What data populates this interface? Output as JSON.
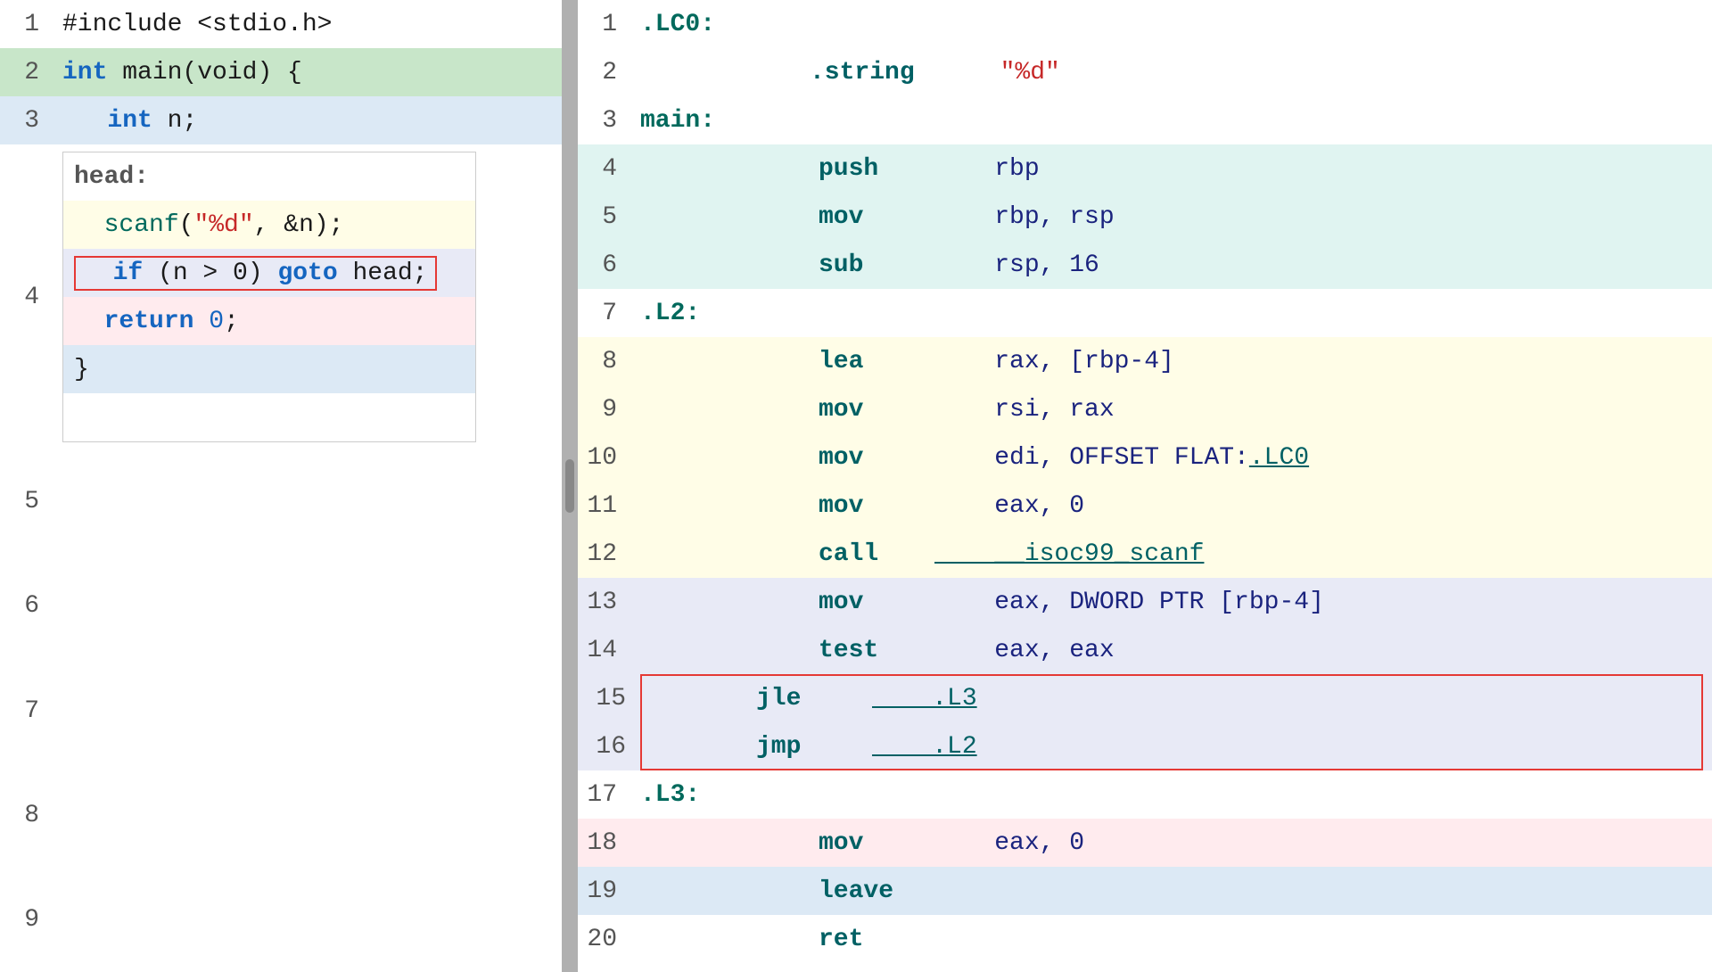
{
  "left": {
    "lines": [
      {
        "num": 1,
        "bg": "bg-white",
        "content": "#include <stdio.h>",
        "type": "plain_include"
      },
      {
        "num": 2,
        "bg": "bg-green-light",
        "content": "int main(void) {",
        "type": "main_decl"
      },
      {
        "num": 3,
        "bg": "bg-blue-light",
        "content": "  int n;",
        "type": "int_n"
      },
      {
        "num": 4,
        "bg": "bg-white",
        "content": "head:",
        "type": "label_head"
      },
      {
        "num": 5,
        "bg": "bg-yellow-light",
        "content": "  scanf(\"%d\", &n);",
        "type": "scanf"
      },
      {
        "num": 6,
        "bg": "bg-purple-light",
        "content": "  if (n > 0) goto head;",
        "type": "if_goto",
        "boxed": true
      },
      {
        "num": 7,
        "bg": "bg-red-light",
        "content": "  return 0;",
        "type": "return"
      },
      {
        "num": 8,
        "bg": "bg-blue-light",
        "content": "}",
        "type": "close_brace"
      },
      {
        "num": 9,
        "bg": "bg-white",
        "content": "",
        "type": "empty"
      }
    ]
  },
  "right": {
    "lines": [
      {
        "num": 1,
        "bg": "bg-white",
        "label": ".LC0:",
        "instr": "",
        "operand": ""
      },
      {
        "num": 2,
        "bg": "bg-white",
        "label": "",
        "instr": ".string",
        "operand": "\"%d\"",
        "operand_type": "str"
      },
      {
        "num": 3,
        "bg": "bg-white",
        "label": "main:",
        "instr": "",
        "operand": ""
      },
      {
        "num": 4,
        "bg": "bg-teal-light",
        "label": "",
        "instr": "push",
        "operand": "rbp"
      },
      {
        "num": 5,
        "bg": "bg-teal-light",
        "label": "",
        "instr": "mov",
        "operand": "rbp, rsp"
      },
      {
        "num": 6,
        "bg": "bg-teal-light",
        "label": "",
        "instr": "sub",
        "operand": "rsp, 16"
      },
      {
        "num": 7,
        "bg": "bg-white",
        "label": ".L2:",
        "instr": "",
        "operand": ""
      },
      {
        "num": 8,
        "bg": "bg-yellow-r",
        "label": "",
        "instr": "lea",
        "operand": "rax, [rbp-4]"
      },
      {
        "num": 9,
        "bg": "bg-yellow-r",
        "label": "",
        "instr": "mov",
        "operand": "rsi, rax"
      },
      {
        "num": 10,
        "bg": "bg-yellow-r",
        "label": "",
        "instr": "mov",
        "operand": "edi, OFFSET FLAT:.LC0",
        "has_link": true,
        "link_part": ".LC0"
      },
      {
        "num": 11,
        "bg": "bg-yellow-r",
        "label": "",
        "instr": "mov",
        "operand": "eax, 0"
      },
      {
        "num": 12,
        "bg": "bg-yellow-r",
        "label": "",
        "instr": "call",
        "operand": "__isoc99_scanf",
        "has_link": true,
        "link_part": "__isoc99_scanf"
      },
      {
        "num": 13,
        "bg": "bg-purple-r",
        "label": "",
        "instr": "mov",
        "operand": "eax, DWORD PTR [rbp-4]"
      },
      {
        "num": 14,
        "bg": "bg-purple-r",
        "label": "",
        "instr": "test",
        "operand": "eax, eax"
      },
      {
        "num": 15,
        "bg": "bg-purple-r",
        "label": "",
        "instr": "jle",
        "operand": ".L3",
        "boxed": true
      },
      {
        "num": 16,
        "bg": "bg-purple-r",
        "label": "",
        "instr": "jmp",
        "operand": ".L2",
        "boxed": true
      },
      {
        "num": 17,
        "bg": "bg-white",
        "label": ".L3:",
        "instr": "",
        "operand": ""
      },
      {
        "num": 18,
        "bg": "bg-red-r",
        "label": "",
        "instr": "mov",
        "operand": "eax, 0"
      },
      {
        "num": 19,
        "bg": "bg-blue-r",
        "label": "",
        "instr": "leave",
        "operand": ""
      },
      {
        "num": 20,
        "bg": "bg-white",
        "label": "",
        "instr": "ret",
        "operand": ""
      }
    ]
  }
}
